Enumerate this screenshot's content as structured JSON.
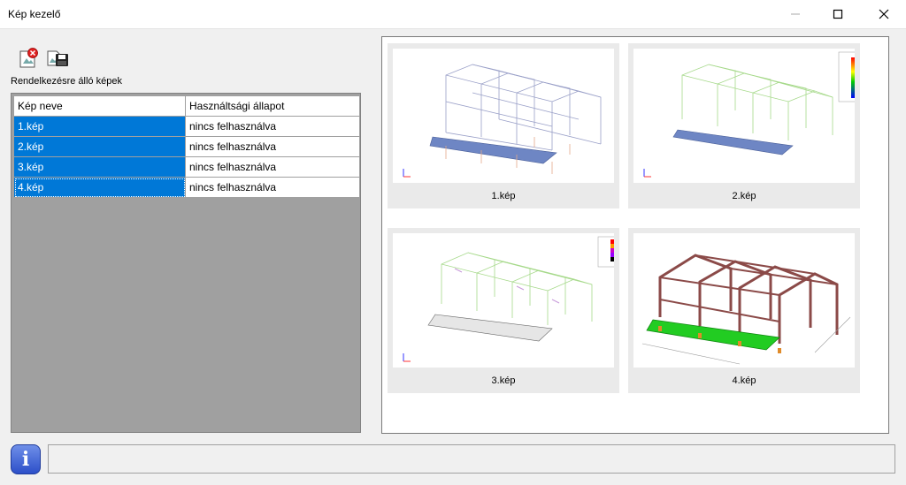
{
  "window": {
    "title": "Kép kezelő"
  },
  "toolbar": {
    "delete_icon": "delete-image-icon",
    "save_icon": "save-image-icon"
  },
  "available_label": "Rendelkezésre álló képek",
  "table": {
    "headers": [
      "Kép neve",
      "Használtsági állapot"
    ],
    "rows": [
      {
        "name": "1.kép",
        "status": "nincs felhasználva"
      },
      {
        "name": "2.kép",
        "status": "nincs felhasználva"
      },
      {
        "name": "3.kép",
        "status": "nincs felhasználva"
      },
      {
        "name": "4.kép",
        "status": "nincs felhasználva"
      }
    ]
  },
  "thumbnails": [
    {
      "caption": "1.kép"
    },
    {
      "caption": "2.kép"
    },
    {
      "caption": "3.kép"
    },
    {
      "caption": "4.kép"
    }
  ],
  "colors": {
    "selection": "#0078d7",
    "info": "#2c4fc9"
  }
}
